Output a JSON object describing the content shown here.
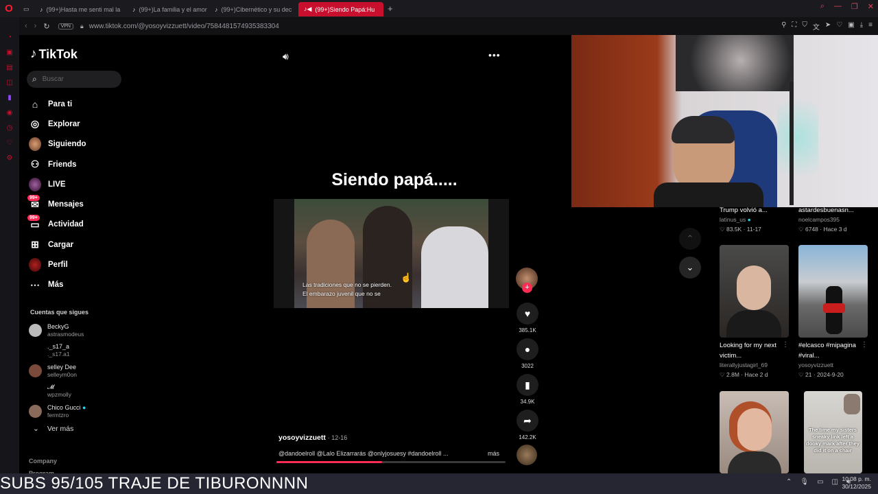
{
  "browser": {
    "tabs": [
      {
        "title": "(99+)Hasta me senti mal la"
      },
      {
        "title": "(99+)La familia y el amor"
      },
      {
        "title": "(99+)Cibernético y su dec"
      },
      {
        "title": "(99+)Siendo Papá:Hu"
      }
    ],
    "vpn_label": "VPN",
    "url": "www.tiktok.com/@yosoyvizzuett/video/7584481574935383304"
  },
  "sidebar": {
    "logo": "TikTok",
    "search_placeholder": "Buscar",
    "menu": [
      {
        "label": "Para ti",
        "icon": "home-icon"
      },
      {
        "label": "Explorar",
        "icon": "compass-icon"
      },
      {
        "label": "Siguiendo",
        "icon": "avatar-icon"
      },
      {
        "label": "Friends",
        "icon": "friends-icon"
      },
      {
        "label": "LIVE",
        "icon": "live-icon"
      },
      {
        "label": "Mensajes",
        "icon": "messages-icon",
        "badge": "99+"
      },
      {
        "label": "Actividad",
        "icon": "activity-icon",
        "badge": "99+"
      },
      {
        "label": "Cargar",
        "icon": "upload-icon"
      },
      {
        "label": "Perfil",
        "icon": "profile-icon"
      },
      {
        "label": "Más",
        "icon": "more-icon"
      }
    ],
    "following_title": "Cuentas que sigues",
    "following": [
      {
        "name": "BeckyG",
        "user": "astrasmodeus"
      },
      {
        "name": "._s17_a",
        "user": "._s17.a1"
      },
      {
        "name": "selley Dee",
        "user": "selleym0on"
      },
      {
        "name": "𝓜",
        "user": "wpzmolly"
      },
      {
        "name": "Chico Gucci",
        "user": "fermtzro"
      }
    ],
    "see_more": "Ver más",
    "footer": [
      "Company",
      "Program"
    ]
  },
  "video": {
    "title": "Siendo papá.....",
    "subtitle_line1": "Las tradiciones que no se pierden.",
    "subtitle_line2": "El embarazo juvenil que no se",
    "author": "yosoyvizzuett",
    "date": "· 12-16",
    "description": "@dandoelroll @Lalo Elizarrarás @onlyjosuesy #dandoelroll ...",
    "more": "más",
    "progress": 0.46
  },
  "actions": {
    "likes": "385.1K",
    "comments": "3022",
    "saves": "34.9K",
    "shares": "142.2K"
  },
  "recommendations": [
    {
      "title": "Trump volvió a...",
      "user": "latinus_us",
      "likes": "83.5K",
      "date": "· 11-17"
    },
    {
      "title": "astardesbuenasn...",
      "user": "noelcampos395",
      "likes": "6748",
      "date": "· Hace 3 d"
    },
    {
      "title": "Looking for my next victim...",
      "user": "literallyjustagirl_69",
      "likes": "2.8M",
      "date": "· Hace 2 d"
    },
    {
      "title": "#elcasco #mipagina #viral...",
      "user": "yosoyvizzuett",
      "likes": "21",
      "date": "· 2024-9-20"
    },
    {
      "thumb_text": "The time my sisters sneaky link left a dooky mark after they did it on a chair"
    }
  ],
  "stream": {
    "ticker": "SUBS 95/105 TRAJE DE TIBURONNNN"
  },
  "taskbar": {
    "time": "10:08 p. m.",
    "date": "30/12/2025"
  },
  "colors": {
    "accent": "#fe2c55",
    "opera_red": "#c8102e"
  }
}
